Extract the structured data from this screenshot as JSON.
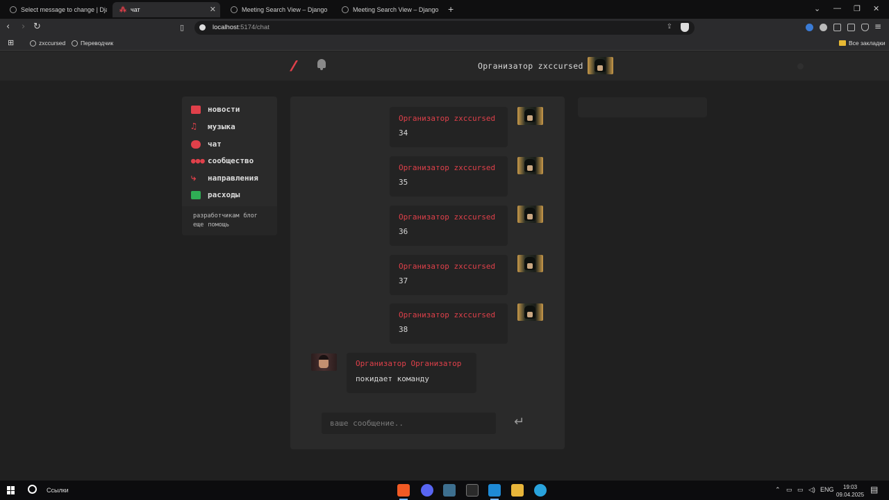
{
  "browser": {
    "tabs": [
      {
        "title": "Select message to change | Django",
        "active": false
      },
      {
        "title": "чат",
        "active": true
      },
      {
        "title": "Meeting Search View – Django REST",
        "active": false
      },
      {
        "title": "Meeting Search View – Django REST",
        "active": false
      }
    ],
    "url_host": "localhost",
    "url_path": ":5174/chat",
    "bookmarks": [
      "zxccursed",
      "Переводчик"
    ],
    "all_bookmarks": "Все закладки"
  },
  "site": {
    "header_user": "Организатор zxccursed",
    "nav": [
      {
        "label": "новости",
        "icon": "newspaper-icon",
        "color": "#e0404a"
      },
      {
        "label": "музыка",
        "icon": "music-icon",
        "color": "#e0404a"
      },
      {
        "label": "чат",
        "icon": "chat-icon",
        "color": "#e0404a"
      },
      {
        "label": "сообщество",
        "icon": "users-icon",
        "color": "#e0404a"
      },
      {
        "label": "направления",
        "icon": "directions-icon",
        "color": "#e0404a"
      },
      {
        "label": "расходы",
        "icon": "money-icon",
        "color": "#2fae55"
      }
    ],
    "footer_links": [
      "разработчикам",
      "блог",
      "еще",
      "помощь"
    ],
    "accent_color": "#e0404a"
  },
  "chat": {
    "messages": [
      {
        "author": "Организатор zxccursed",
        "text": "34"
      },
      {
        "author": "Организатор zxccursed",
        "text": "35"
      },
      {
        "author": "Организатор zxccursed",
        "text": "36"
      },
      {
        "author": "Организатор zxccursed",
        "text": "37"
      },
      {
        "author": "Организатор zxccursed",
        "text": "38"
      },
      {
        "author": "Организатор Организатор",
        "text": "покидает команду"
      }
    ],
    "input_placeholder": "ваше сообщение.."
  },
  "taskbar": {
    "search_label": "Ссылки",
    "lang": "ENG",
    "time": "19:03",
    "date": "09.04.2025"
  }
}
